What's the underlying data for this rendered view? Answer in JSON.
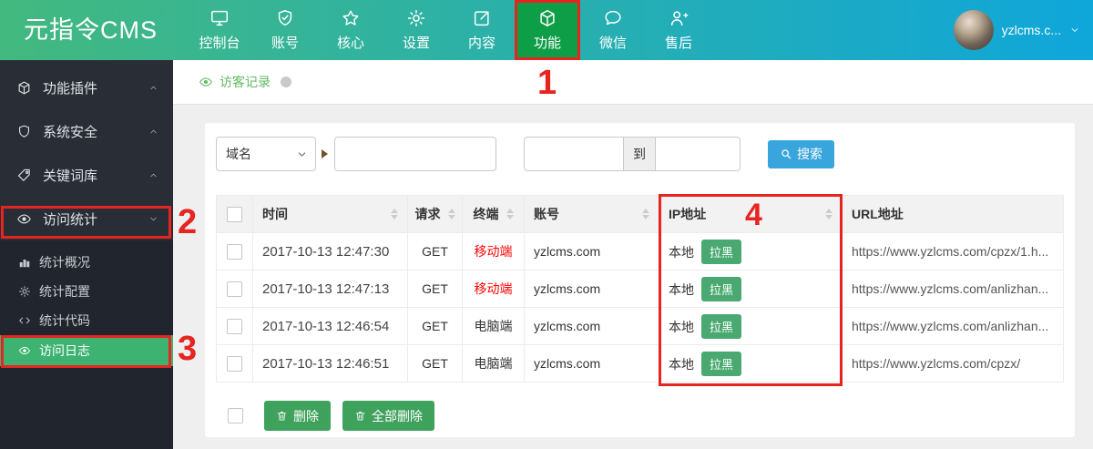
{
  "colors": {
    "topbar_gradient_left": "#43b97f",
    "topbar_gradient_right": "#0fa6da",
    "active_nav_green": "#0f9e48",
    "sidebar_bg": "#282d36",
    "submenu_bg": "#21262e",
    "sidebar_active_green": "#3db271",
    "button_green": "#3fa25c",
    "blacklist_green": "#4aa971",
    "search_blue": "#38a5dc",
    "annotation_red": "#e62420",
    "mobile_device_red": "#ff0000",
    "breadcrumb_green": "#62b962"
  },
  "topbar": {
    "logo": "元指令CMS",
    "nav": [
      {
        "label": "控制台",
        "icon": "monitor-icon",
        "active": false
      },
      {
        "label": "账号",
        "icon": "shield-check-icon",
        "active": false
      },
      {
        "label": "核心",
        "icon": "star-icon",
        "active": false
      },
      {
        "label": "设置",
        "icon": "gear-icon",
        "active": false
      },
      {
        "label": "内容",
        "icon": "edit-icon",
        "active": false
      },
      {
        "label": "功能",
        "icon": "cube-icon",
        "active": true
      },
      {
        "label": "微信",
        "icon": "chat-icon",
        "active": false
      },
      {
        "label": "售后",
        "icon": "user-plus-icon",
        "active": false
      }
    ],
    "user": {
      "name": "yzlcms.c..."
    }
  },
  "sidebar": {
    "items": [
      {
        "label": "功能插件",
        "icon": "cube-icon",
        "state": "collapsed"
      },
      {
        "label": "系统安全",
        "icon": "shield-icon",
        "state": "collapsed"
      },
      {
        "label": "关键词库",
        "icon": "tag-icon",
        "state": "collapsed"
      },
      {
        "label": "访问统计",
        "icon": "eye-icon",
        "state": "expanded"
      }
    ],
    "submenu": [
      {
        "label": "统计概况",
        "icon": "bar-chart-icon",
        "active": false
      },
      {
        "label": "统计配置",
        "icon": "gear-icon",
        "active": false
      },
      {
        "label": "统计代码",
        "icon": "code-icon",
        "active": false
      },
      {
        "label": "访问日志",
        "icon": "eye-icon",
        "active": true
      }
    ]
  },
  "breadcrumb": {
    "label": "访客记录"
  },
  "filters": {
    "field_select": "域名",
    "keyword_value": "",
    "date_from": "",
    "to_label": "到",
    "date_to": "",
    "search_label": "搜索"
  },
  "table": {
    "headers": [
      {
        "label": "时间",
        "sortable": true
      },
      {
        "label": "请求",
        "sortable": true
      },
      {
        "label": "终端",
        "sortable": true
      },
      {
        "label": "账号",
        "sortable": true
      },
      {
        "label": "IP地址",
        "sortable": true
      },
      {
        "label": "URL地址",
        "sortable": false
      }
    ],
    "rows": [
      {
        "time": "2017-10-13 12:47:30",
        "method": "GET",
        "device": "移动端",
        "device_type": "mobile",
        "account": "yzlcms.com",
        "ip": "本地",
        "blacklist": "拉黑",
        "url": "https://www.yzlcms.com/cpzx/1.h..."
      },
      {
        "time": "2017-10-13 12:47:13",
        "method": "GET",
        "device": "移动端",
        "device_type": "mobile",
        "account": "yzlcms.com",
        "ip": "本地",
        "blacklist": "拉黑",
        "url": "https://www.yzlcms.com/anlizhan..."
      },
      {
        "time": "2017-10-13 12:46:54",
        "method": "GET",
        "device": "电脑端",
        "device_type": "pc",
        "account": "yzlcms.com",
        "ip": "本地",
        "blacklist": "拉黑",
        "url": "https://www.yzlcms.com/anlizhan..."
      },
      {
        "time": "2017-10-13 12:46:51",
        "method": "GET",
        "device": "电脑端",
        "device_type": "pc",
        "account": "yzlcms.com",
        "ip": "本地",
        "blacklist": "拉黑",
        "url": "https://www.yzlcms.com/cpzx/"
      }
    ]
  },
  "actions": {
    "delete_label": "删除",
    "delete_all_label": "全部删除"
  },
  "annotations": {
    "step1": "1",
    "step2": "2",
    "step3": "3",
    "step4": "4"
  }
}
